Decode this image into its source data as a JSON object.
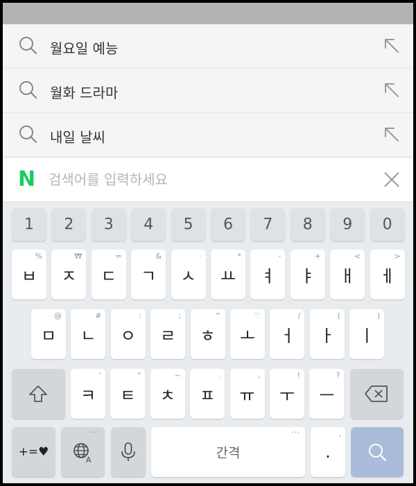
{
  "suggestions": [
    {
      "text": "월요일 예능",
      "icon": "search-icon",
      "action": "arrow-up-left-icon"
    },
    {
      "text": "월화 드라마",
      "icon": "search-icon",
      "action": "arrow-up-left-icon"
    },
    {
      "text": "내일 날씨",
      "icon": "search-icon",
      "action": "arrow-up-left-icon"
    }
  ],
  "search": {
    "logo": "N",
    "placeholder": "검색어를 입력하세요",
    "value": ""
  },
  "keyboard": {
    "numbers": [
      "1",
      "2",
      "3",
      "4",
      "5",
      "6",
      "7",
      "8",
      "9",
      "0"
    ],
    "row1": [
      {
        "main": "ㅂ",
        "sub": "%"
      },
      {
        "main": "ㅈ",
        "sub": "₩"
      },
      {
        "main": "ㄷ",
        "sub": "="
      },
      {
        "main": "ㄱ",
        "sub": "&"
      },
      {
        "main": "ㅅ",
        "sub": "·"
      },
      {
        "main": "ㅛ",
        "sub": "*"
      },
      {
        "main": "ㅕ",
        "sub": "-"
      },
      {
        "main": "ㅑ",
        "sub": "+"
      },
      {
        "main": "ㅐ",
        "sub": "<"
      },
      {
        "main": "ㅔ",
        "sub": ">"
      }
    ],
    "row2": [
      {
        "main": "ㅁ",
        "sub": "@"
      },
      {
        "main": "ㄴ",
        "sub": "#"
      },
      {
        "main": "ㅇ",
        "sub": ":"
      },
      {
        "main": "ㄹ",
        "sub": ";"
      },
      {
        "main": "ㅎ",
        "sub": "^"
      },
      {
        "main": "ㅗ",
        "sub": "♡"
      },
      {
        "main": "ㅓ",
        "sub": "/"
      },
      {
        "main": "ㅏ",
        "sub": "("
      },
      {
        "main": "ㅣ",
        "sub": ")"
      }
    ],
    "row3": [
      {
        "main": "ㅋ",
        "sub": "'"
      },
      {
        "main": "ㅌ",
        "sub": "\""
      },
      {
        "main": "ㅊ",
        "sub": "~"
      },
      {
        "main": "ㅍ",
        "sub": "."
      },
      {
        "main": "ㅠ",
        "sub": ","
      },
      {
        "main": "ㅜ",
        "sub": "!"
      },
      {
        "main": "ㅡ",
        "sub": "?"
      }
    ],
    "symbols_label": "+=♥",
    "space_label": "간격",
    "period_label": ".",
    "period_sub": ",",
    "more_dots": "···",
    "colors": {
      "accent": "#19ce60",
      "search_key": "#a9bcd9"
    }
  }
}
